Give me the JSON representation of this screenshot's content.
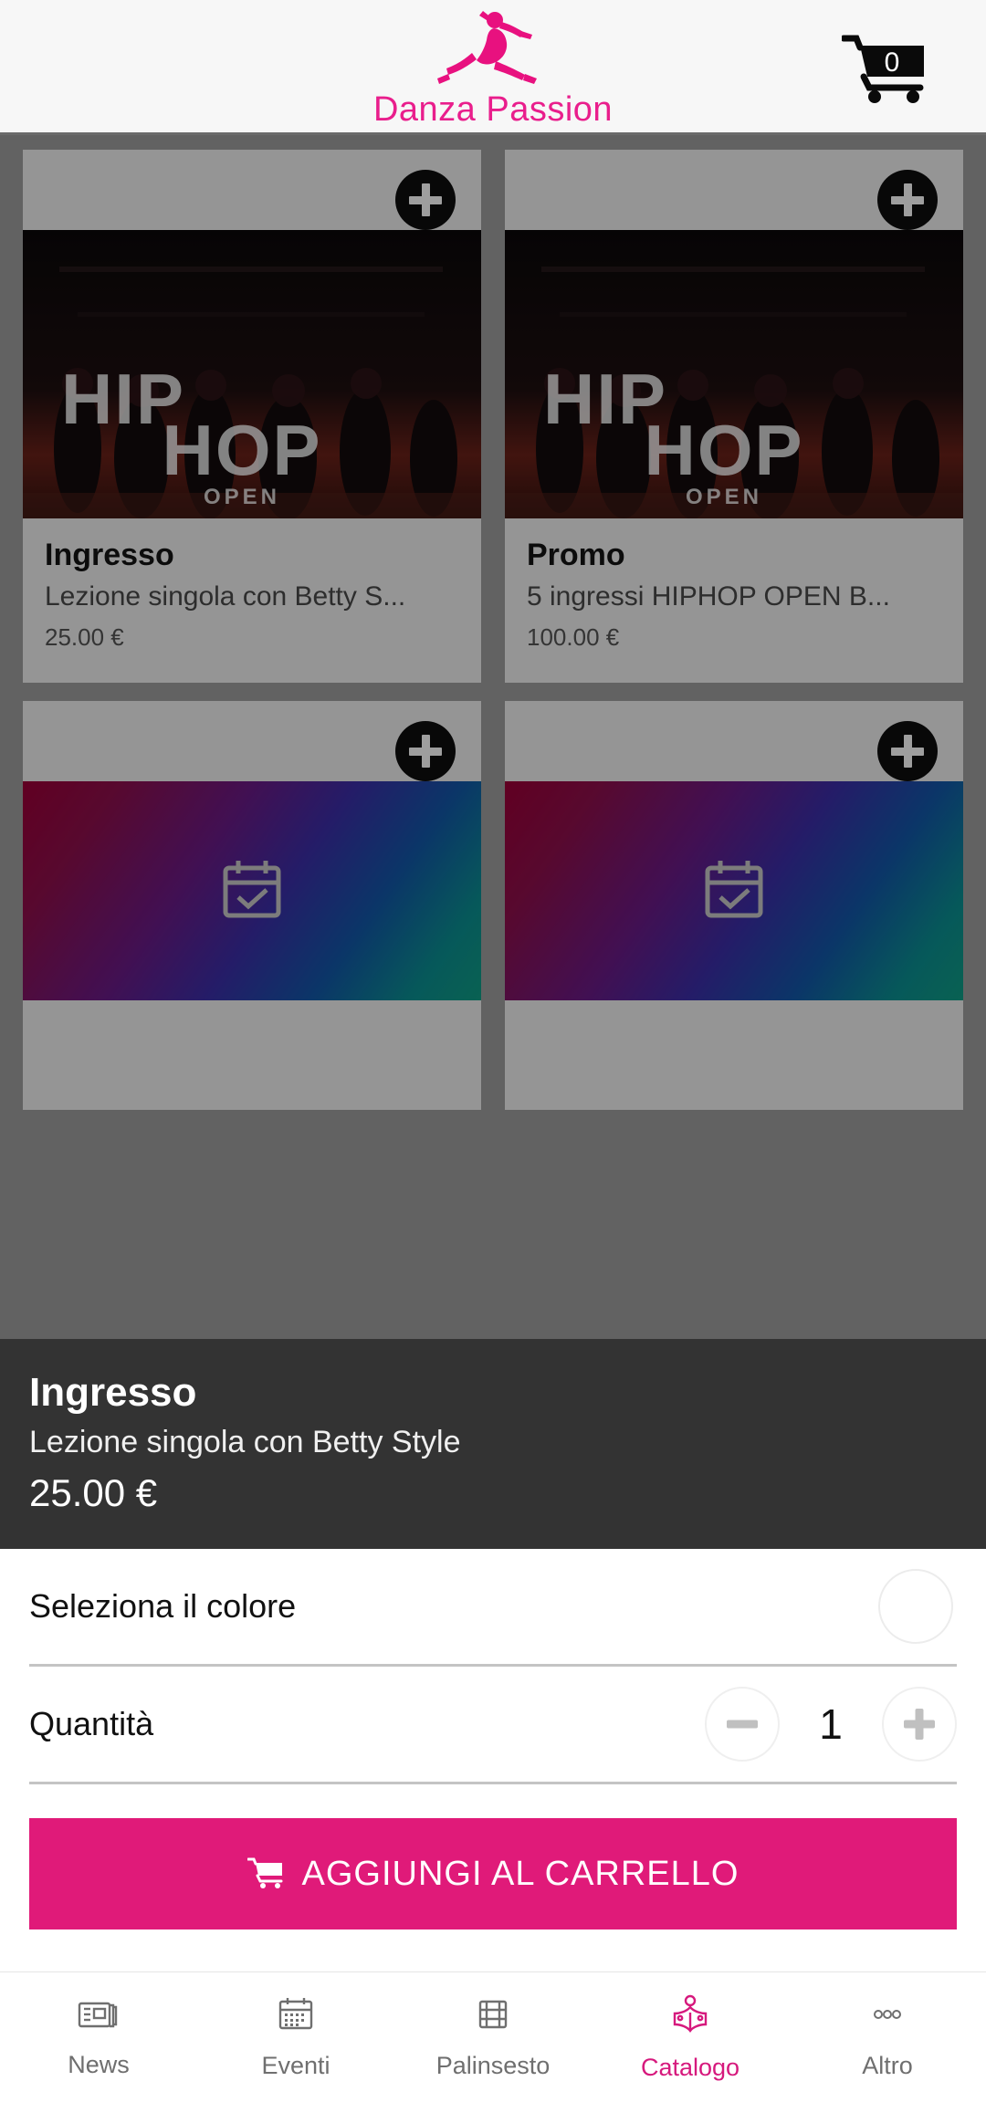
{
  "header": {
    "brand_name": "Danza Passion",
    "logo_icon": "dancer-logo-icon",
    "cart_icon": "shopping-cart-icon",
    "cart_count": "0",
    "brand_color": "#e91e8c"
  },
  "catalog": {
    "products": [
      {
        "plus_icon": "plus-circle-icon",
        "media_type": "photo",
        "media_text_line1": "HIP",
        "media_text_line2": "HOP",
        "media_text_line3": "OPEN",
        "title": "Ingresso",
        "subtitle": "Lezione singola con Betty S...",
        "price": "25.00 €"
      },
      {
        "plus_icon": "plus-circle-icon",
        "media_type": "photo",
        "media_text_line1": "HIP",
        "media_text_line2": "HOP",
        "media_text_line3": "OPEN",
        "title": "Promo",
        "subtitle": "5 ingressi HIPHOP OPEN B...",
        "price": "100.00 €"
      },
      {
        "plus_icon": "plus-circle-icon",
        "media_type": "gradient",
        "media_icon": "calendar-check-icon",
        "title": "",
        "subtitle": "",
        "price": ""
      },
      {
        "plus_icon": "plus-circle-icon",
        "media_type": "gradient",
        "media_icon": "calendar-check-icon",
        "title": "",
        "subtitle": "",
        "price": ""
      }
    ]
  },
  "detail_sheet": {
    "title": "Ingresso",
    "subtitle": "Lezione singola con Betty Style",
    "price": "25.00 €",
    "color_label": "Seleziona il colore",
    "color_value": "",
    "color_swatch": "#ffffff",
    "quantity_label": "Quantità",
    "quantity_value": "1",
    "minus_icon": "minus-circle-icon",
    "plus_icon": "plus-circle-icon",
    "add_to_cart_label": "AGGIUNGI AL CARRELLO",
    "add_to_cart_icon": "cart-icon",
    "accent_color": "#e01a79"
  },
  "bottom_nav": {
    "items": [
      {
        "label": "News",
        "icon": "news-icon",
        "active": false
      },
      {
        "label": "Eventi",
        "icon": "calendar-icon",
        "active": false
      },
      {
        "label": "Palinsesto",
        "icon": "film-strip-icon",
        "active": false
      },
      {
        "label": "Catalogo",
        "icon": "open-book-icon",
        "active": true
      },
      {
        "label": "Altro",
        "icon": "more-dots-icon",
        "active": false
      }
    ],
    "active_color": "#d6197d",
    "inactive_color": "#6f6f6f"
  }
}
